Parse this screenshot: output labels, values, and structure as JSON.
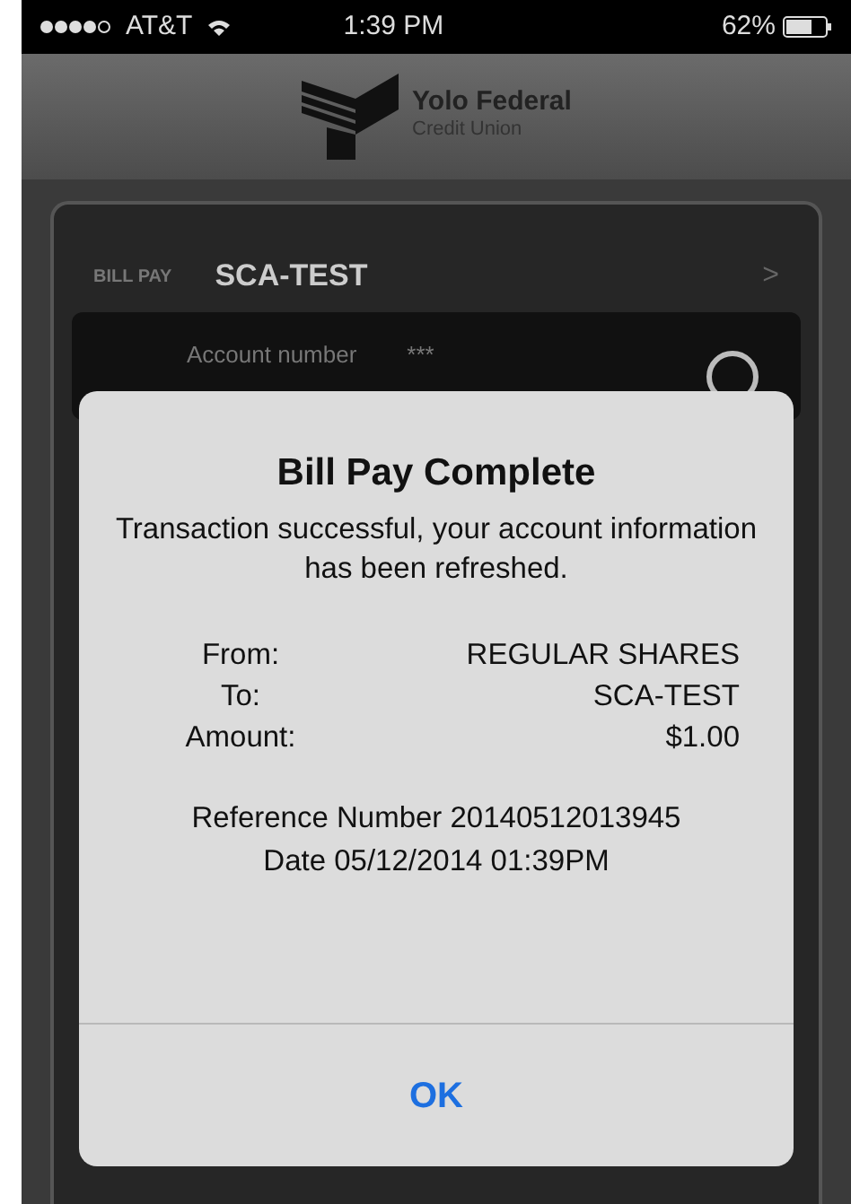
{
  "status_bar": {
    "carrier": "AT&T",
    "time": "1:39 PM",
    "battery": "62%"
  },
  "logo": {
    "name": "Yolo Federal",
    "subtitle": "Credit Union"
  },
  "header": {
    "section": "BILL PAY",
    "payee": "SCA-TEST",
    "next": ">"
  },
  "account_row": {
    "label": "Account number",
    "value": "***"
  },
  "dialog": {
    "title": "Bill Pay Complete",
    "message": "Transaction successful, your account information has been refreshed.",
    "details": [
      {
        "label": "From:",
        "value": "REGULAR SHARES"
      },
      {
        "label": "To:",
        "value": "SCA-TEST"
      },
      {
        "label": "Amount:",
        "value": "$1.00"
      }
    ],
    "reference": "Reference Number 20140512013945",
    "date": "Date 05/12/2014 01:39PM",
    "button": "OK"
  }
}
